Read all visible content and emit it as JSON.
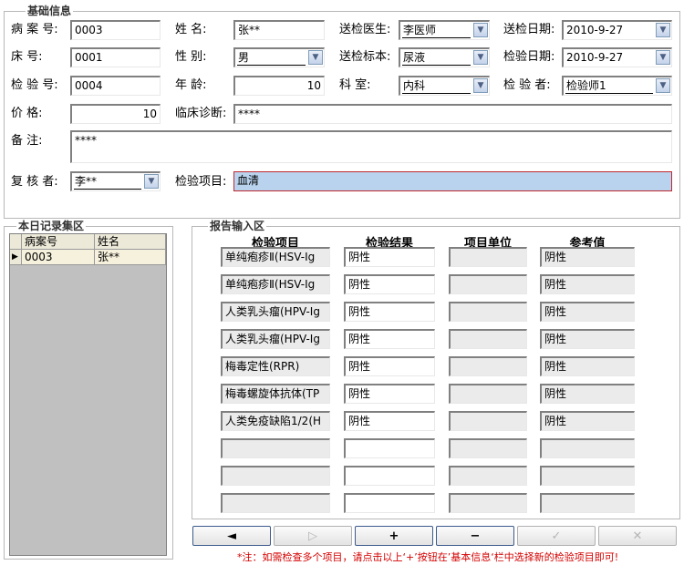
{
  "basic_info": {
    "title": "基础信息",
    "labels": {
      "case_no": "病 案 号:",
      "bed_no": "床    号:",
      "test_no": "检 验 号:",
      "price": "价    格:",
      "remarks": "备    注:",
      "reviewer": "复 核 者:",
      "name": "姓    名:",
      "gender": "性    别:",
      "age": "年    龄:",
      "diagnosis": "临床诊断:",
      "test_item": "检验项目:",
      "doctor": "送检医生:",
      "specimen": "送检标本:",
      "dept": "科    室:",
      "send_date": "送检日期:",
      "test_date": "检验日期:",
      "tester": "检 验 者:"
    },
    "values": {
      "case_no": "0003",
      "bed_no": "0001",
      "test_no": "0004",
      "price": "10",
      "remarks": "****",
      "reviewer": "李**",
      "name": "张**",
      "gender": "男",
      "age": "10",
      "diagnosis": "****",
      "test_item": "血清",
      "doctor": "李医师",
      "specimen": "尿液",
      "dept": "内科",
      "send_date": "2010-9-27",
      "test_date": "2010-9-27",
      "tester": "检验师1"
    }
  },
  "records": {
    "title": "本日记录集区",
    "headers": [
      "病案号",
      "姓名"
    ],
    "rows": [
      [
        "0003",
        "张**"
      ]
    ]
  },
  "report": {
    "title": "报告输入区",
    "headers": [
      "检验项目",
      "检验结果",
      "项目单位",
      "参考值"
    ],
    "rows": [
      [
        "单纯疱疹Ⅱ(HSV-Ig",
        "阴性",
        "",
        "阴性"
      ],
      [
        "单纯疱疹Ⅱ(HSV-Ig",
        "阴性",
        "",
        "阴性"
      ],
      [
        "人类乳头瘤(HPV-Ig",
        "阴性",
        "",
        "阴性"
      ],
      [
        "人类乳头瘤(HPV-Ig",
        "阴性",
        "",
        "阴性"
      ],
      [
        "梅毒定性(RPR)",
        "阴性",
        "",
        "阴性"
      ],
      [
        "梅毒螺旋体抗体(TP",
        "阴性",
        "",
        "阴性"
      ],
      [
        "人类免疫缺陷1/2(H",
        "阴性",
        "",
        "阴性"
      ],
      [
        "",
        "",
        "",
        ""
      ],
      [
        "",
        "",
        "",
        ""
      ],
      [
        "",
        "",
        "",
        ""
      ]
    ]
  },
  "nav": [
    "◄",
    "▷",
    "+",
    "−",
    "✓",
    "✕"
  ],
  "note": "*注：如需检查多个项目，请点击以上‘+’按钮在’基本信息‘栏中选择新的检验项目即可!"
}
